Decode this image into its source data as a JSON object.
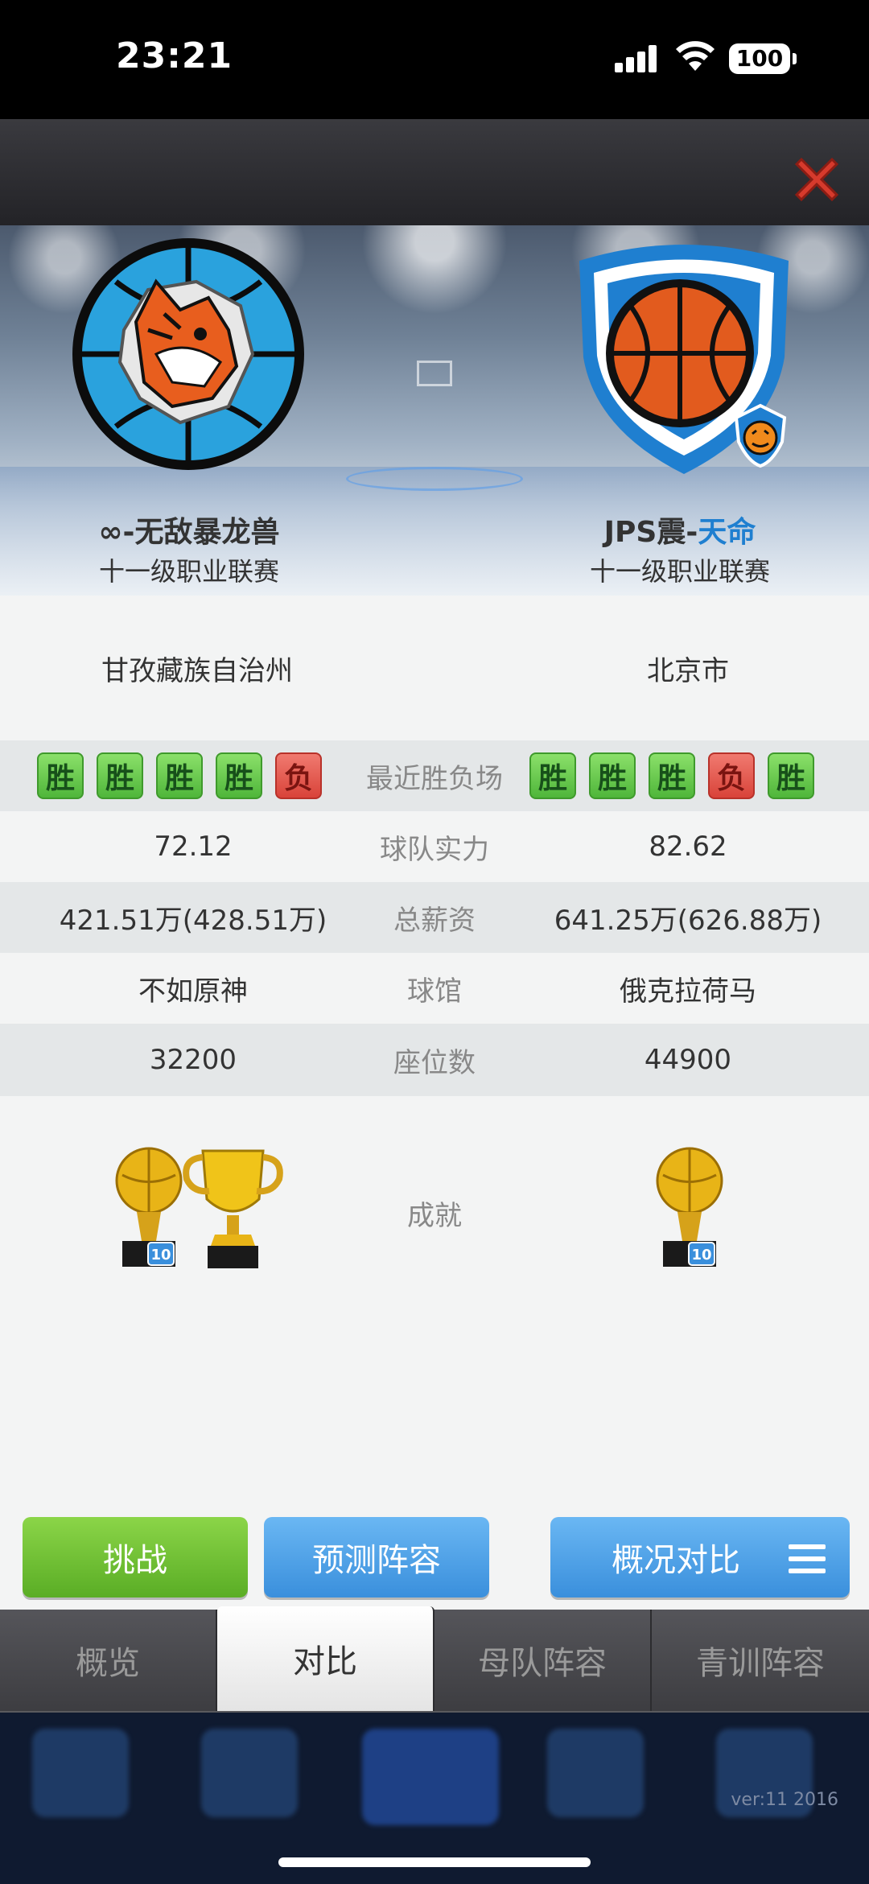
{
  "status_bar": {
    "time": "23:21",
    "battery": "100"
  },
  "teams": {
    "left": {
      "name": "∞-无敌暴龙兽",
      "league": "十一级职业联赛",
      "logo_icon": "tiger-basketball-logo-icon"
    },
    "right": {
      "name_prefix": "JPS震-",
      "name_accent": "天命",
      "league": "十一级职业联赛",
      "logo_icon": "basketball-shield-logo-icon"
    }
  },
  "stats": {
    "region": {
      "left": "甘孜藏族自治州",
      "right": "北京市"
    },
    "recent": {
      "label": "最近胜负场",
      "left": [
        "胜",
        "胜",
        "胜",
        "胜",
        "负"
      ],
      "right": [
        "胜",
        "胜",
        "胜",
        "负",
        "胜"
      ]
    },
    "strength": {
      "label": "球队实力",
      "left": "72.12",
      "right": "82.62"
    },
    "salary": {
      "label": "总薪资",
      "left": "421.51万(428.51万)",
      "right": "641.25万(626.88万)"
    },
    "arena": {
      "label": "球馆",
      "left": "不如原神",
      "right": "俄克拉荷马"
    },
    "seats": {
      "label": "座位数",
      "left": "32200",
      "right": "44900"
    },
    "achievement": {
      "label": "成就",
      "left_badge": "10",
      "right_badge": "10"
    }
  },
  "actions": {
    "challenge": "挑战",
    "predict": "预测阵容",
    "compare": "概况对比"
  },
  "tabs": [
    "概览",
    "对比",
    "母队阵容",
    "青训阵容"
  ],
  "active_tab": "对比",
  "version": "ver:11  2016",
  "colors": {
    "win": "#5ec23f",
    "loss": "#e0473d",
    "accent_blue": "#1f7fd0",
    "challenge_green": "#6cc232",
    "blue_button": "#4a9de4"
  }
}
